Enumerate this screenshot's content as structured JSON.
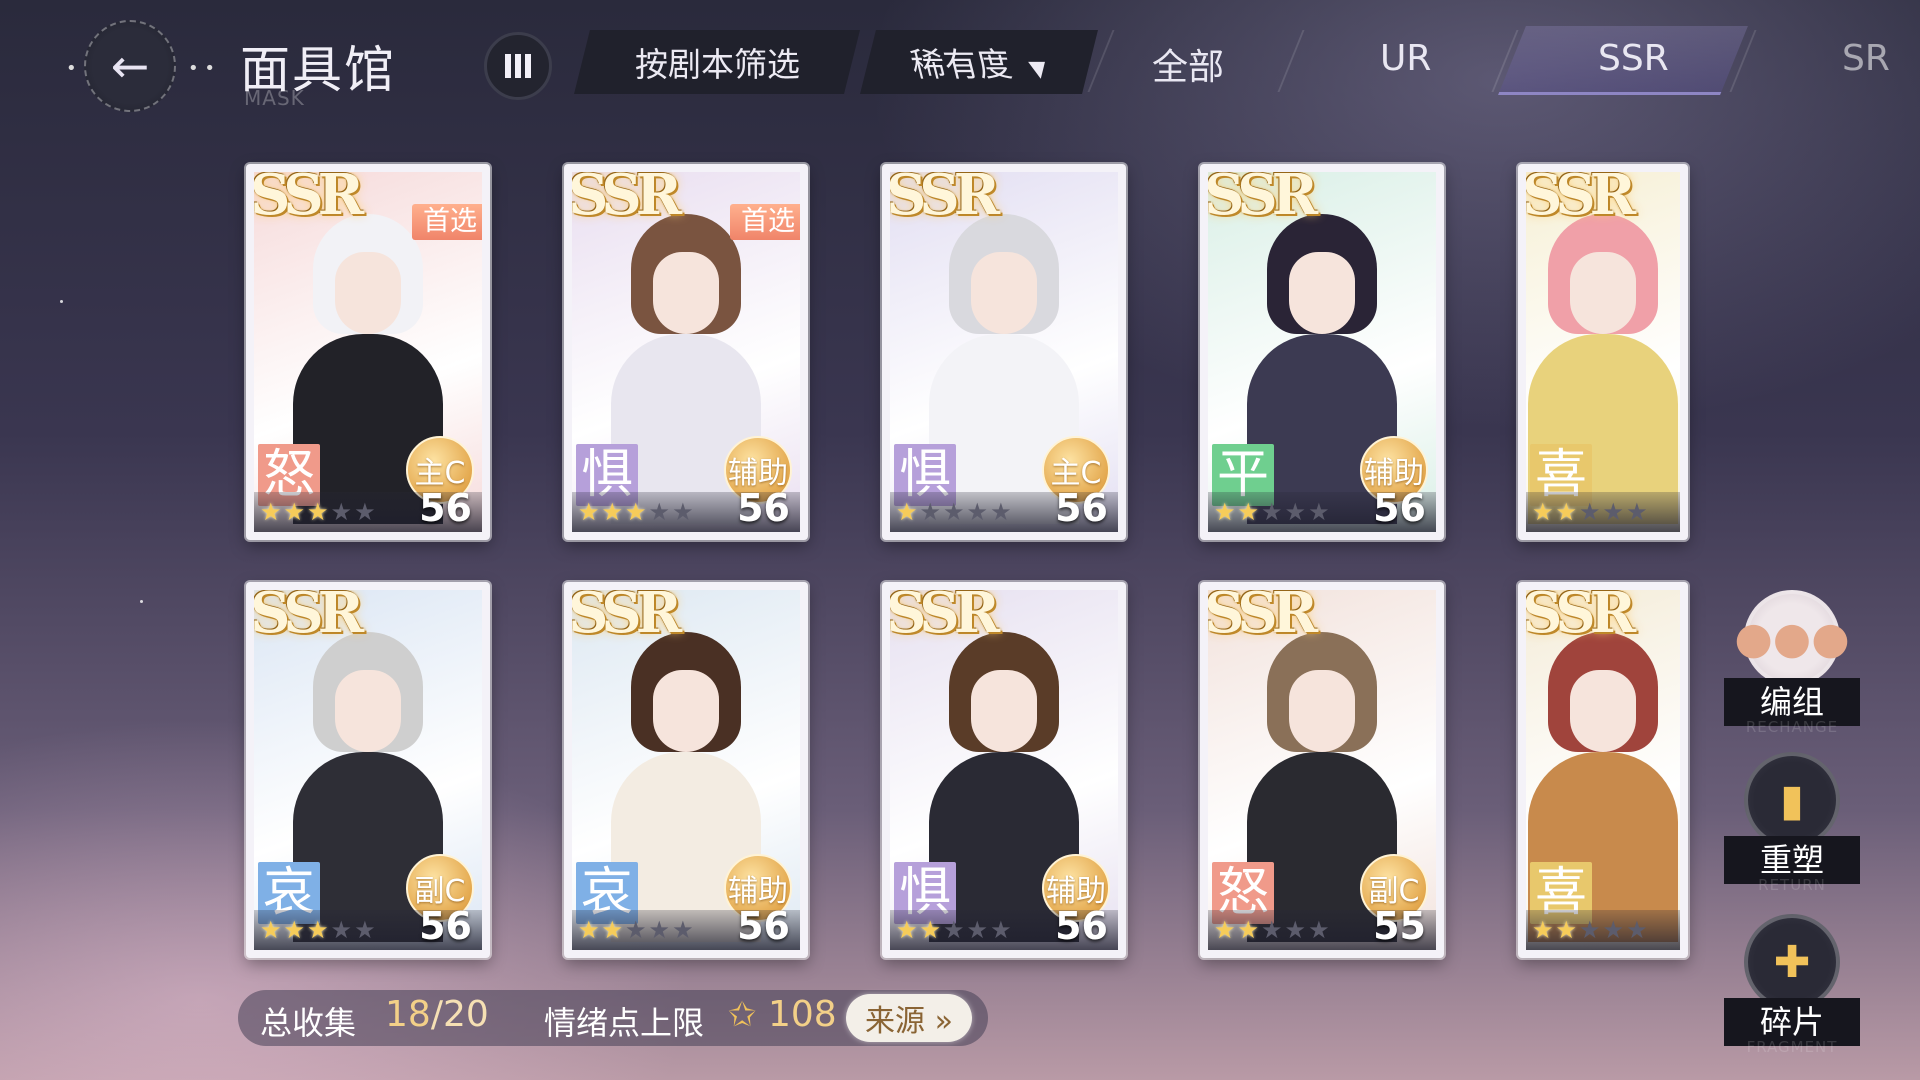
{
  "header": {
    "title": "面具馆",
    "subtitle": "MASK",
    "filter_script": "按剧本筛选",
    "filter_rarity": "稀有度",
    "tabs": [
      {
        "label": "全部"
      },
      {
        "label": "UR"
      },
      {
        "label": "SSR"
      },
      {
        "label": "SR"
      }
    ],
    "active_tab": "SSR"
  },
  "cards": [
    {
      "rarity": "SSR",
      "pick": "首选",
      "emotion": "怒",
      "role": "主C",
      "stars": 3,
      "max_stars": 5,
      "level": "56"
    },
    {
      "rarity": "SSR",
      "pick": "首选",
      "emotion": "惧",
      "role": "辅助",
      "stars": 3,
      "max_stars": 5,
      "level": "56"
    },
    {
      "rarity": "SSR",
      "pick": "",
      "emotion": "惧",
      "role": "主C",
      "stars": 1,
      "max_stars": 5,
      "level": "56"
    },
    {
      "rarity": "SSR",
      "pick": "",
      "emotion": "平",
      "role": "辅助",
      "stars": 2,
      "max_stars": 5,
      "level": "56"
    },
    {
      "rarity": "SSR",
      "pick": "",
      "emotion": "喜",
      "role": "",
      "stars": 2,
      "max_stars": 5,
      "level": ""
    },
    {
      "rarity": "SSR",
      "pick": "",
      "emotion": "哀",
      "role": "副C",
      "stars": 3,
      "max_stars": 5,
      "level": "56"
    },
    {
      "rarity": "SSR",
      "pick": "",
      "emotion": "哀",
      "role": "辅助",
      "stars": 2,
      "max_stars": 5,
      "level": "56"
    },
    {
      "rarity": "SSR",
      "pick": "",
      "emotion": "惧",
      "role": "辅助",
      "stars": 2,
      "max_stars": 5,
      "level": "56"
    },
    {
      "rarity": "SSR",
      "pick": "",
      "emotion": "怒",
      "role": "副C",
      "stars": 2,
      "max_stars": 5,
      "level": "55"
    },
    {
      "rarity": "SSR",
      "pick": "",
      "emotion": "喜",
      "role": "",
      "stars": 2,
      "max_stars": 5,
      "level": ""
    }
  ],
  "footer": {
    "collect_label": "总收集",
    "collect_count": "18",
    "collect_total": "/20",
    "emotion_label": "情绪点上限",
    "emotion_value": "108",
    "source_button": "来源 »"
  },
  "side_buttons": [
    {
      "label": "编组",
      "sub": "RECHANGE",
      "icon": "group-icon"
    },
    {
      "label": "重塑",
      "sub": "RETURN",
      "icon": "reshape-card-icon"
    },
    {
      "label": "碎片",
      "sub": "FRAGMENT",
      "icon": "puzzle-icon"
    }
  ],
  "colors": {
    "emotion_anger": "#f09a8a",
    "emotion_fear": "#b6a0da",
    "emotion_calm": "#6fcf8f",
    "emotion_joy": "#e8c86c",
    "emotion_sorrow": "#7fb0e6",
    "accent_gold": "#f3d088"
  }
}
